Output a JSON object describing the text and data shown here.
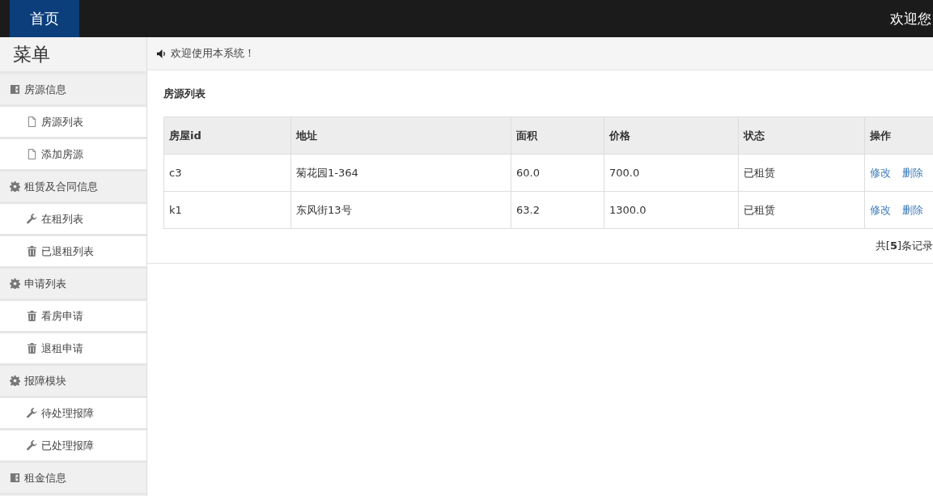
{
  "topbar": {
    "home_tab": "首页",
    "welcome": "欢迎您"
  },
  "sidebar": {
    "title": "菜单",
    "items": [
      {
        "kind": "group",
        "label": "房源信息"
      },
      {
        "kind": "item",
        "label": "房源列表"
      },
      {
        "kind": "item",
        "label": "添加房源"
      },
      {
        "kind": "group",
        "label": "租赁及合同信息"
      },
      {
        "kind": "item",
        "label": "在租列表"
      },
      {
        "kind": "item",
        "label": "已退租列表"
      },
      {
        "kind": "group",
        "label": "申请列表"
      },
      {
        "kind": "item",
        "label": "看房申请"
      },
      {
        "kind": "item",
        "label": "退租申请"
      },
      {
        "kind": "group",
        "label": "报障模块"
      },
      {
        "kind": "item",
        "label": "待处理报障"
      },
      {
        "kind": "item",
        "label": "已处理报障"
      },
      {
        "kind": "group",
        "label": "租金信息"
      }
    ]
  },
  "notice": "欢迎使用本系统！",
  "section_title": "房源列表",
  "table": {
    "columns": [
      "房屋id",
      "地址",
      "面积",
      "价格",
      "状态",
      "操作"
    ],
    "rows": [
      {
        "cells": [
          "c3",
          "菊花园1-364",
          "60.0",
          "700.0",
          "已租赁"
        ],
        "actions": [
          "修改",
          "删除"
        ]
      },
      {
        "cells": [
          "k1",
          "东风街13号",
          "63.2",
          "1300.0",
          "已租赁"
        ],
        "actions": [
          "修改",
          "删除"
        ]
      }
    ]
  },
  "footer": "共[**5**]条记录"
}
